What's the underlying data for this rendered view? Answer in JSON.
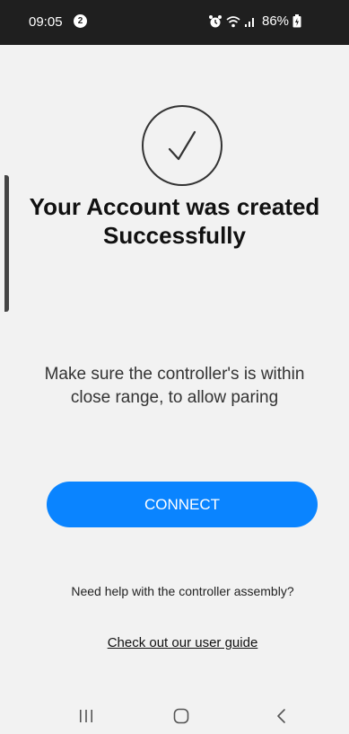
{
  "status_bar": {
    "time": "09:05",
    "notification_count": "2",
    "battery": "86%",
    "icons": [
      "alarm-icon",
      "wifi-icon",
      "signal-icon",
      "battery-icon"
    ]
  },
  "main": {
    "title_line1": "Your Account was created",
    "title_line2": "Successfully",
    "instruction_line1": "Make sure the controller's is within",
    "instruction_line2": "close range, to allow paring",
    "connect_label": "CONNECT",
    "help_text": "Need help with the controller assembly?",
    "guide_link": "Check out our user guide",
    "success_icon": "checkmark-circle-icon"
  },
  "nav_bar": {
    "buttons": [
      "recents-icon",
      "home-icon",
      "back-icon"
    ]
  },
  "colors": {
    "accent": "#0a84ff",
    "background": "#f2f2f2",
    "status_bar": "#1f1f1f"
  }
}
